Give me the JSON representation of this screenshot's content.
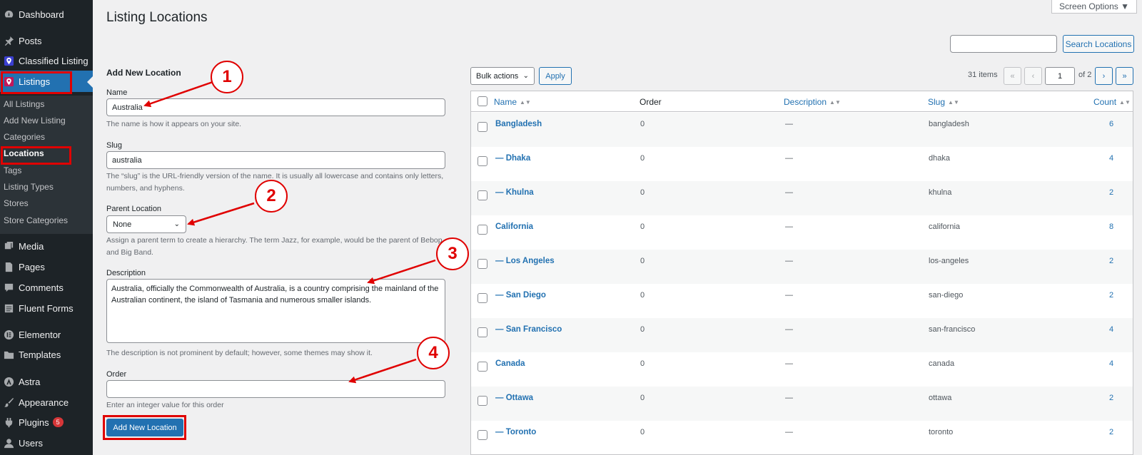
{
  "sidebar": {
    "menu": [
      {
        "label": "Dashboard",
        "icon": "dashboard-icon"
      },
      {
        "label": "Posts",
        "icon": "pin-icon"
      },
      {
        "label": "Classified Listing",
        "icon": "location-pin-icon"
      },
      {
        "label": "Listings",
        "icon": "location-pin-icon"
      },
      {
        "label": "Media",
        "icon": "media-icon"
      },
      {
        "label": "Pages",
        "icon": "pages-icon"
      },
      {
        "label": "Comments",
        "icon": "comments-icon"
      },
      {
        "label": "Fluent Forms",
        "icon": "forms-icon"
      },
      {
        "label": "Elementor",
        "icon": "elementor-icon"
      },
      {
        "label": "Templates",
        "icon": "folder-icon"
      },
      {
        "label": "Astra",
        "icon": "astra-icon"
      },
      {
        "label": "Appearance",
        "icon": "brush-icon"
      },
      {
        "label": "Plugins",
        "icon": "plug-icon",
        "badge": "5"
      },
      {
        "label": "Users",
        "icon": "user-icon"
      }
    ],
    "submenu": [
      {
        "label": "All Listings"
      },
      {
        "label": "Add New Listing"
      },
      {
        "label": "Categories"
      },
      {
        "label": "Locations"
      },
      {
        "label": "Tags"
      },
      {
        "label": "Listing Types"
      },
      {
        "label": "Stores"
      },
      {
        "label": "Store Categories"
      }
    ]
  },
  "header": {
    "title": "Listing Locations",
    "screen_options": "Screen Options ▼",
    "search_button": "Search Locations",
    "search_value": ""
  },
  "form": {
    "heading": "Add New Location",
    "name_label": "Name",
    "name_value": "Australia",
    "name_help": "The name is how it appears on your site.",
    "slug_label": "Slug",
    "slug_value": "australia",
    "slug_help": "The “slug” is the URL-friendly version of the name. It is usually all lowercase and contains only letters, numbers, and hyphens.",
    "parent_label": "Parent Location",
    "parent_value": "None",
    "parent_help": "Assign a parent term to create a hierarchy. The term Jazz, for example, would be the parent of Bebop and Big Band.",
    "description_label": "Description",
    "description_value": "Australia, officially the Commonwealth of Australia, is a country comprising the mainland of the Australian continent, the island of Tasmania and numerous smaller islands.",
    "description_help": "The description is not prominent by default; however, some themes may show it.",
    "order_label": "Order",
    "order_value": "",
    "order_help": "Enter an integer value for this order",
    "submit_label": "Add New Location"
  },
  "callouts": [
    "1",
    "2",
    "3",
    "4"
  ],
  "table": {
    "bulk_actions": "Bulk actions",
    "apply": "Apply",
    "items_count": "31 items",
    "first_page": "«",
    "prev_page": "‹",
    "current_page": "1",
    "of_pages": "of 2",
    "next_page": "›",
    "last_page": "»",
    "columns": [
      "Name",
      "Order",
      "Description",
      "Slug",
      "Count"
    ],
    "rows": [
      {
        "name": "Bangladesh",
        "order": "0",
        "description": "—",
        "slug": "bangladesh",
        "count": "6"
      },
      {
        "name": "— Dhaka",
        "order": "0",
        "description": "—",
        "slug": "dhaka",
        "count": "4"
      },
      {
        "name": "— Khulna",
        "order": "0",
        "description": "—",
        "slug": "khulna",
        "count": "2"
      },
      {
        "name": "California",
        "order": "0",
        "description": "—",
        "slug": "california",
        "count": "8"
      },
      {
        "name": "— Los Angeles",
        "order": "0",
        "description": "—",
        "slug": "los-angeles",
        "count": "2"
      },
      {
        "name": "— San Diego",
        "order": "0",
        "description": "—",
        "slug": "san-diego",
        "count": "2"
      },
      {
        "name": "— San Francisco",
        "order": "0",
        "description": "—",
        "slug": "san-francisco",
        "count": "4"
      },
      {
        "name": "Canada",
        "order": "0",
        "description": "—",
        "slug": "canada",
        "count": "4"
      },
      {
        "name": "— Ottawa",
        "order": "0",
        "description": "—",
        "slug": "ottawa",
        "count": "2"
      },
      {
        "name": "— Toronto",
        "order": "0",
        "description": "—",
        "slug": "toronto",
        "count": "2"
      }
    ]
  },
  "colors": {
    "accent": "#2271b1",
    "sidebar_bg": "#1d2327",
    "annotation": "#e00000"
  }
}
